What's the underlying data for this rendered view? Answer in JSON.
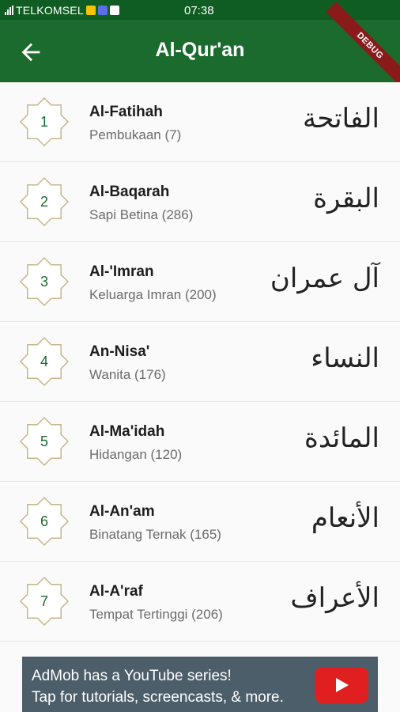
{
  "status_bar": {
    "carrier": "TELKOMSEL",
    "time": "07:38",
    "icons": [
      "signal-icon",
      "notification-icon",
      "notification-icon",
      "mail-icon"
    ]
  },
  "app_bar": {
    "title": "Al-Qur'an",
    "back_icon": "arrow-left-icon",
    "debug_label": "DEBUG"
  },
  "surahs": [
    {
      "number": "1",
      "name": "Al-Fatihah",
      "meaning": "Pembukaan (7)",
      "arabic": "الفاتحة"
    },
    {
      "number": "2",
      "name": "Al-Baqarah",
      "meaning": "Sapi Betina (286)",
      "arabic": "البقرة"
    },
    {
      "number": "3",
      "name": "Al-'Imran",
      "meaning": "Keluarga Imran (200)",
      "arabic": "آل عمران"
    },
    {
      "number": "4",
      "name": "An-Nisa'",
      "meaning": "Wanita (176)",
      "arabic": "النساء"
    },
    {
      "number": "5",
      "name": "Al-Ma'idah",
      "meaning": "Hidangan (120)",
      "arabic": "المائدة"
    },
    {
      "number": "6",
      "name": "Al-An'am",
      "meaning": "Binatang Ternak (165)",
      "arabic": "الأنعام"
    },
    {
      "number": "7",
      "name": "Al-A'raf",
      "meaning": "Tempat Tertinggi (206)",
      "arabic": "الأعراف"
    }
  ],
  "ad": {
    "line1": "AdMob has a YouTube series!",
    "line2": "Tap for tutorials, screencasts, & more.",
    "icon": "youtube-play-icon"
  },
  "colors": {
    "primary": "#1b6b2e",
    "status_bar": "#0f5d22",
    "badge_outline": "#c9b58a",
    "ad_background": "#4d5e6b"
  }
}
